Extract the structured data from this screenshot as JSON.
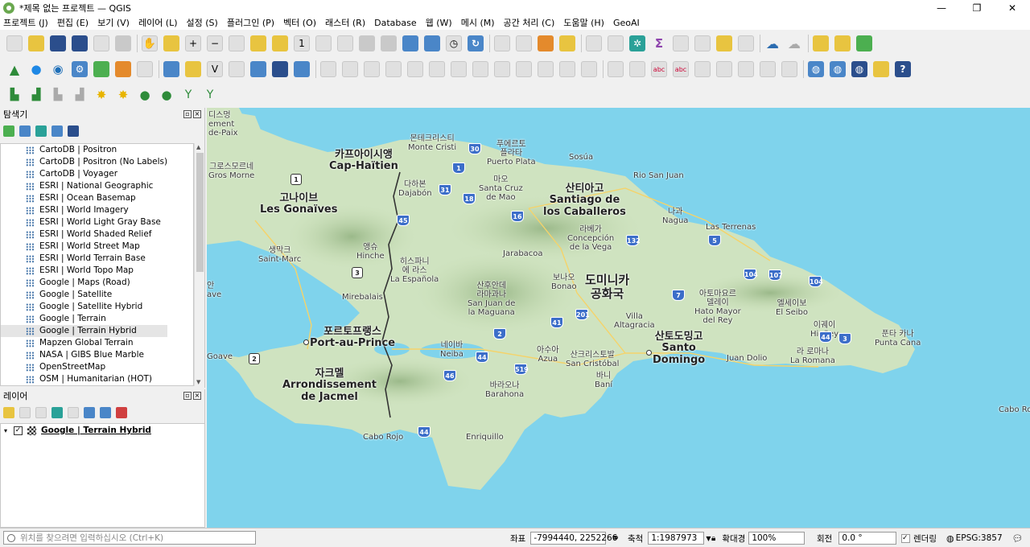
{
  "window": {
    "title": "*제목 없는 프로젝트 — QGIS",
    "controls": [
      "—",
      "❐",
      "✕"
    ]
  },
  "menubar": [
    "프로젝트 (J)",
    "편집 (E)",
    "보기 (V)",
    "레이어 (L)",
    "설정 (S)",
    "플러그인 (P)",
    "벡터 (O)",
    "래스터 (R)",
    "Database",
    "웹 (W)",
    "메시 (M)",
    "공간 처리 (C)",
    "도움말 (H)",
    "GeoAI"
  ],
  "toolbar_icons": {
    "row1": [
      "new-project-icon",
      "open-project-icon",
      "save-project-icon",
      "save-as-icon",
      "print-layout-icon",
      "style-manager-icon",
      "pan-icon",
      "pan-to-selection-icon",
      "zoom-in-icon",
      "zoom-out-icon",
      "zoom-full-icon",
      "zoom-to-selection-icon",
      "zoom-to-layer-icon",
      "zoom-native-icon",
      "zoom-last-icon",
      "zoom-next-icon",
      "new-map-view-icon",
      "new-3d-view-icon",
      "temporal-icon",
      "bookmark-icon",
      "show-bookmarks-icon",
      "clock-icon",
      "refresh-icon",
      "select-features-icon",
      "select-value-icon",
      "deselect-icon",
      "select-location-icon",
      "identify-icon",
      "attribute-table-icon",
      "field-calc-icon",
      "statistics-icon",
      "measure-icon",
      "annotation-icon",
      "map-tips-icon",
      "cloud-icon",
      "cloud-sync-icon",
      "plugin-cube-icon",
      "plugin-cube2-icon",
      "tools-icon"
    ],
    "row2": [
      "digitize-tree-icon",
      "water-drop-icon",
      "eye-icon",
      "gear-icon",
      "grid-icon",
      "grid2-icon",
      "calendar-icon",
      "add-vector-icon",
      "add-raster-icon",
      "add-xyz-icon",
      "add-wms-icon",
      "add-mesh-icon",
      "add-virtual-icon",
      "edit-pencil-icon",
      "edit-pencil2-icon",
      "add-point-icon",
      "add-line-icon",
      "vertex-tool-icon",
      "save-edits-icon",
      "delete-icon",
      "cut-icon",
      "copy-icon",
      "paste-icon",
      "undo-icon",
      "redo-icon",
      "label-icon",
      "label2-icon",
      "abc-label-icon",
      "abc-label2-icon",
      "pin-label-icon",
      "show-label-icon",
      "move-label-icon",
      "rotate-label-icon",
      "change-label-icon",
      "globe-icon",
      "globe2-icon",
      "globe3-icon",
      "python-icon",
      "help-icon"
    ],
    "row3": [
      "profile-icon",
      "profile2-icon",
      "profile3-icon",
      "profile4-icon",
      "new-layer-star-icon",
      "new-layer-star2-icon",
      "new-layer-star3-icon",
      "new-layer-star4-icon",
      "filter-add-icon",
      "filter-add2-icon"
    ]
  },
  "browser": {
    "title": "탐색기",
    "items": [
      "CartoDB | Positron",
      "CartoDB | Positron (No Labels)",
      "CartoDB | Voyager",
      "ESRI | National Geographic",
      "ESRI | Ocean Basemap",
      "ESRI | World Imagery",
      "ESRI | World Light Gray Base",
      "ESRI | World Shaded Relief",
      "ESRI | World Street Map",
      "ESRI | World Terrain Base",
      "ESRI | World Topo Map",
      "Google | Maps (Road)",
      "Google | Satellite",
      "Google | Satellite Hybrid",
      "Google | Terrain",
      "Google | Terrain Hybrid",
      "Mapzen Global Terrain",
      "NASA | GIBS Blue Marble",
      "OpenStreetMap",
      "OSM | Humanitarian (HOT)"
    ],
    "selected": "Google | Terrain Hybrid"
  },
  "layers": {
    "title": "레이어",
    "items": [
      {
        "name": "Google | Terrain Hybrid",
        "checked": "✓"
      }
    ]
  },
  "map": {
    "labels": {
      "port_de_paix_kr": "디스멍",
      "port_de_paix_a": "ement",
      "port_de_paix_b": "de-Paix",
      "gros_morne_kr": "그로스모르네",
      "gros_morne": "Gros Morne",
      "cap_haitien_kr": "카프아이시앵",
      "cap_haitien": "Cap-Haïtien",
      "monte_cristi_kr": "몬테크리스티",
      "monte_cristi": "Monte Cristi",
      "puerto_plata_kr": "푸에르토\n플라타",
      "puerto_plata": "Puerto Plata",
      "sosua": "Sosúa",
      "dajabon_kr": "다하본",
      "dajabon": "Dajabón",
      "mao_kr": "마오",
      "mao": "Santa Cruz\nde Mao",
      "santiago_kr": "산티아고",
      "santiago": "Santiago de\nlos Caballeros",
      "rio_san_juan": "Rio San Juan",
      "gonaives_kr": "고나이브",
      "gonaives": "Les Gonaïves",
      "nagua_kr": "나과",
      "nagua": "Nagua",
      "las_terrenas": "Las Terrenas",
      "la_vega_kr": "라베가",
      "la_vega": "Concepción\nde la Vega",
      "saint_marc_kr": "생막크",
      "saint_marc": "Saint-Marc",
      "hinche_kr": "앵슈",
      "hinche": "Hinche",
      "jarabacoa": "Jarabacoa",
      "elias_pina_kr": "히스파니\n에 라스",
      "la_espanola": "La Española",
      "bonao_kr": "보나오",
      "bonao": "Bonao",
      "dr_kr_1": "도미니카",
      "dr_kr_2": "공화국",
      "san_juan_kr": "산후안데\n라마과나",
      "san_juan": "San Juan de\nla Maguana",
      "mirebalais": "Mirebalais",
      "hato_mayor_kr": "아토마요르\n델레이",
      "hato_mayor": "Hato Mayor\ndel Rey",
      "el_seibo_kr": "엘세이보",
      "el_seibo": "El Seibo",
      "higuey_kr": "이궤이",
      "higuey": "Higüey",
      "villa_altagracia": "Villa\nAltagracia",
      "pap_kr": "포르토프랭스",
      "pap": "Port-au-Prince",
      "neiba_kr": "네이바",
      "neiba": "Neiba",
      "azua_kr": "아수아",
      "azua": "Azua",
      "san_cristobal_kr": "산크리스토발",
      "san_cristobal": "San Cristóbal",
      "sd_kr": "산토도밍고",
      "sd_1": "Santo",
      "sd_2": "Domingo",
      "juan_dolio": "Juan Dolio",
      "la_romana_kr": "라 로마나",
      "la_romana": "La Romana",
      "punta_cana_kr": "푼타 카나",
      "punta_cana": "Punta Cana",
      "leogane": "Goave",
      "jacmel_kr": "자크멜",
      "jacmel": "Arrondissement\nde Jacmel",
      "bani_kr": "바니",
      "bani": "Baní",
      "barahona_kr": "바라오나",
      "barahona": "Barahona",
      "cabo_rojo": "Cabo Rojo",
      "enriquillo": "Enriquillo",
      "cabo_rojo_pr": "Cabo Rol",
      "left_edge_1": "안",
      "left_edge_2": "ave"
    },
    "route_shields": [
      "30",
      "1",
      "31",
      "18",
      "45",
      "16",
      "132",
      "5",
      "1",
      "3",
      "104",
      "107",
      "104",
      "7",
      "2",
      "201",
      "41",
      "44",
      "2",
      "519",
      "44",
      "46",
      "3",
      "44"
    ]
  },
  "statusbar": {
    "locator_placeholder": "위치를 찾으려면 입력하십시오 (Ctrl+K)",
    "coord_label": "좌표",
    "coord_value": "-7994440, 2252266",
    "scale_label": "축척",
    "scale_value": "1:1987973",
    "magnifier_label": "확대경",
    "magnifier_value": "100%",
    "rotation_label": "회전",
    "rotation_value": "0.0 °",
    "render_label": "렌더링",
    "render_checked": "✓",
    "crs": "EPSG:3857"
  }
}
